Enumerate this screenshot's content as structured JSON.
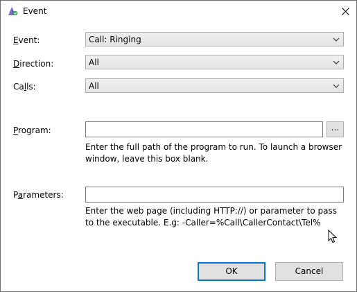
{
  "window": {
    "title": "Event"
  },
  "form": {
    "event": {
      "label_access": "E",
      "label_rest": "vent:",
      "value": "Call: Ringing"
    },
    "direction": {
      "label_access": "D",
      "label_rest": "irection:",
      "value": "All"
    },
    "calls": {
      "label_pre": "Ca",
      "label_access": "l",
      "label_rest": "ls:",
      "value": "All"
    },
    "program": {
      "label_access": "P",
      "label_rest": "rogram:",
      "value": "",
      "browse_label": "...",
      "hint": "Enter the full path of the program to run. To launch a browser window, leave this box blank."
    },
    "parameters": {
      "label_pre": "P",
      "label_access": "a",
      "label_rest": "rameters:",
      "value": "",
      "hint": "Enter the web page (including HTTP://) or parameter to pass to the executable. E.g: -Caller=%Call\\CallerContact\\Tel%"
    }
  },
  "buttons": {
    "ok": "OK",
    "cancel": "Cancel"
  },
  "colors": {
    "accent": "#0078d7",
    "button_face": "#e1e1e1"
  },
  "icons": {
    "app": "app-icon",
    "close": "close-icon",
    "dropdown": "chevron-down-icon",
    "cursor": "mouse-cursor-icon"
  }
}
